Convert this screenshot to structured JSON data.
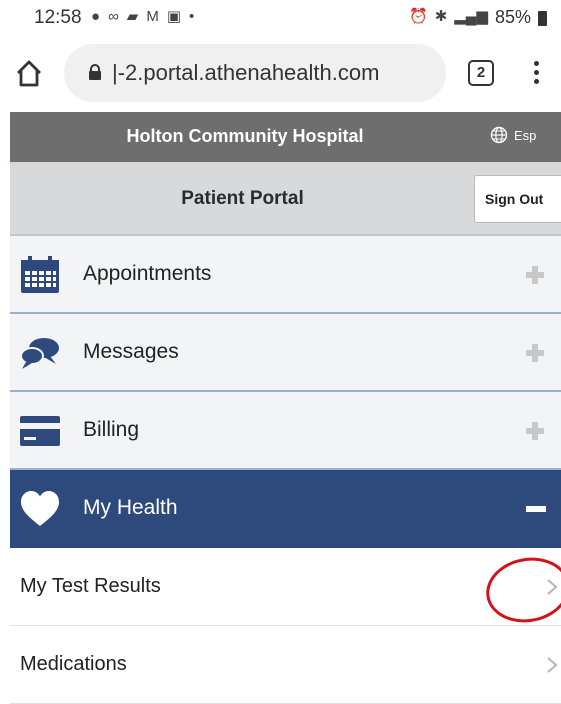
{
  "status": {
    "time": "12:58",
    "battery": "85%"
  },
  "browser": {
    "url": "|-2.portal.athenahealth.com",
    "tab_count": "2"
  },
  "header": {
    "hospital_name": "Holton Community Hospital",
    "language_label": "Esp"
  },
  "portal": {
    "title": "Patient Portal",
    "sign_out_label": "Sign Out"
  },
  "nav": [
    {
      "label": "Appointments",
      "icon": "calendar-icon",
      "state": "collapsed"
    },
    {
      "label": "Messages",
      "icon": "chat-bubbles-icon",
      "state": "collapsed"
    },
    {
      "label": "Billing",
      "icon": "credit-card-icon",
      "state": "collapsed"
    },
    {
      "label": "My Health",
      "icon": "heart-icon",
      "state": "expanded"
    }
  ],
  "my_health_items": [
    {
      "label": "My Test Results"
    },
    {
      "label": "Medications"
    }
  ],
  "colors": {
    "hospital_bar": "#6e6e6e",
    "portal_bar": "#d7d9db",
    "accent_blue": "#2e4a7d",
    "annotation_red": "#d8101a"
  }
}
